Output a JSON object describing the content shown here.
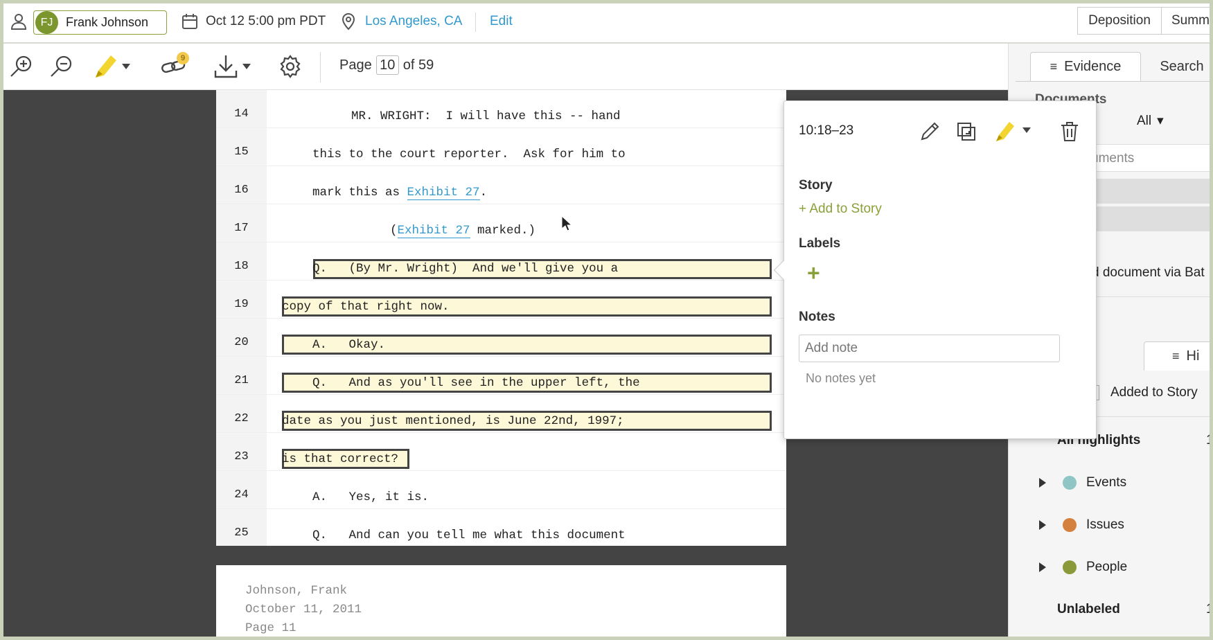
{
  "topbar": {
    "user_initials": "FJ",
    "user_name": "Frank Johnson",
    "date": "Oct 12 5:00 pm PDT",
    "location": "Los Angeles, CA",
    "edit": "Edit",
    "tab_deposition": "Deposition",
    "tab_summary": "Summ"
  },
  "toolbar": {
    "link_badge": "9",
    "page_label": "Page",
    "page_value": "10",
    "page_of": "of 59"
  },
  "transcript": {
    "lines": [
      {
        "num": "14",
        "text": "MR. WRIGHT:  I will have this -- hand"
      },
      {
        "num": "15",
        "text": "this to the court reporter.  Ask for him to"
      },
      {
        "num": "16",
        "pre": "mark this as ",
        "link": "Exhibit 27",
        "post": "."
      },
      {
        "num": "17",
        "pre": "(",
        "link": "Exhibit 27",
        "post": " marked.)"
      },
      {
        "num": "18",
        "text": "Q.   (By Mr. Wright)  And we'll give you a"
      },
      {
        "num": "19",
        "text": "copy of that right now."
      },
      {
        "num": "20",
        "text": "A.   Okay."
      },
      {
        "num": "21",
        "text": "Q.   And as you'll see in the upper left, the"
      },
      {
        "num": "22",
        "text": "date as you just mentioned, is June 22nd, 1997;"
      },
      {
        "num": "23",
        "text": "is that correct?"
      },
      {
        "num": "24",
        "text": "A.   Yes, it is."
      },
      {
        "num": "25",
        "text": "Q.   And can you tell me what this document"
      }
    ],
    "footer_name": "Johnson, Frank",
    "footer_date": "October 11, 2011",
    "footer_page": "Page 11"
  },
  "popover": {
    "range": "10:18–23",
    "story_heading": "Story",
    "add_to_story": "+ Add to Story",
    "labels_heading": "Labels",
    "add_label": "+",
    "notes_heading": "Notes",
    "note_placeholder": "Add note",
    "no_notes": "No notes yet"
  },
  "right_panel": {
    "tab_evidence": "Evidence",
    "tab_search": "Search",
    "documents_heading": "Documents",
    "filter_all": "All",
    "search_placeholder": "uments",
    "doc_link": "d document via Bat",
    "tab_highlights": "Hi",
    "added_to_story": "Added to Story",
    "all_highlights": "All highlights",
    "all_highlights_count": "1",
    "groups": [
      {
        "name": "Events",
        "color": "#8fc5c4"
      },
      {
        "name": "Issues",
        "color": "#d4813f"
      },
      {
        "name": "People",
        "color": "#8a9a3a"
      }
    ],
    "unlabeled": "Unlabeled",
    "unlabeled_count": "1"
  }
}
